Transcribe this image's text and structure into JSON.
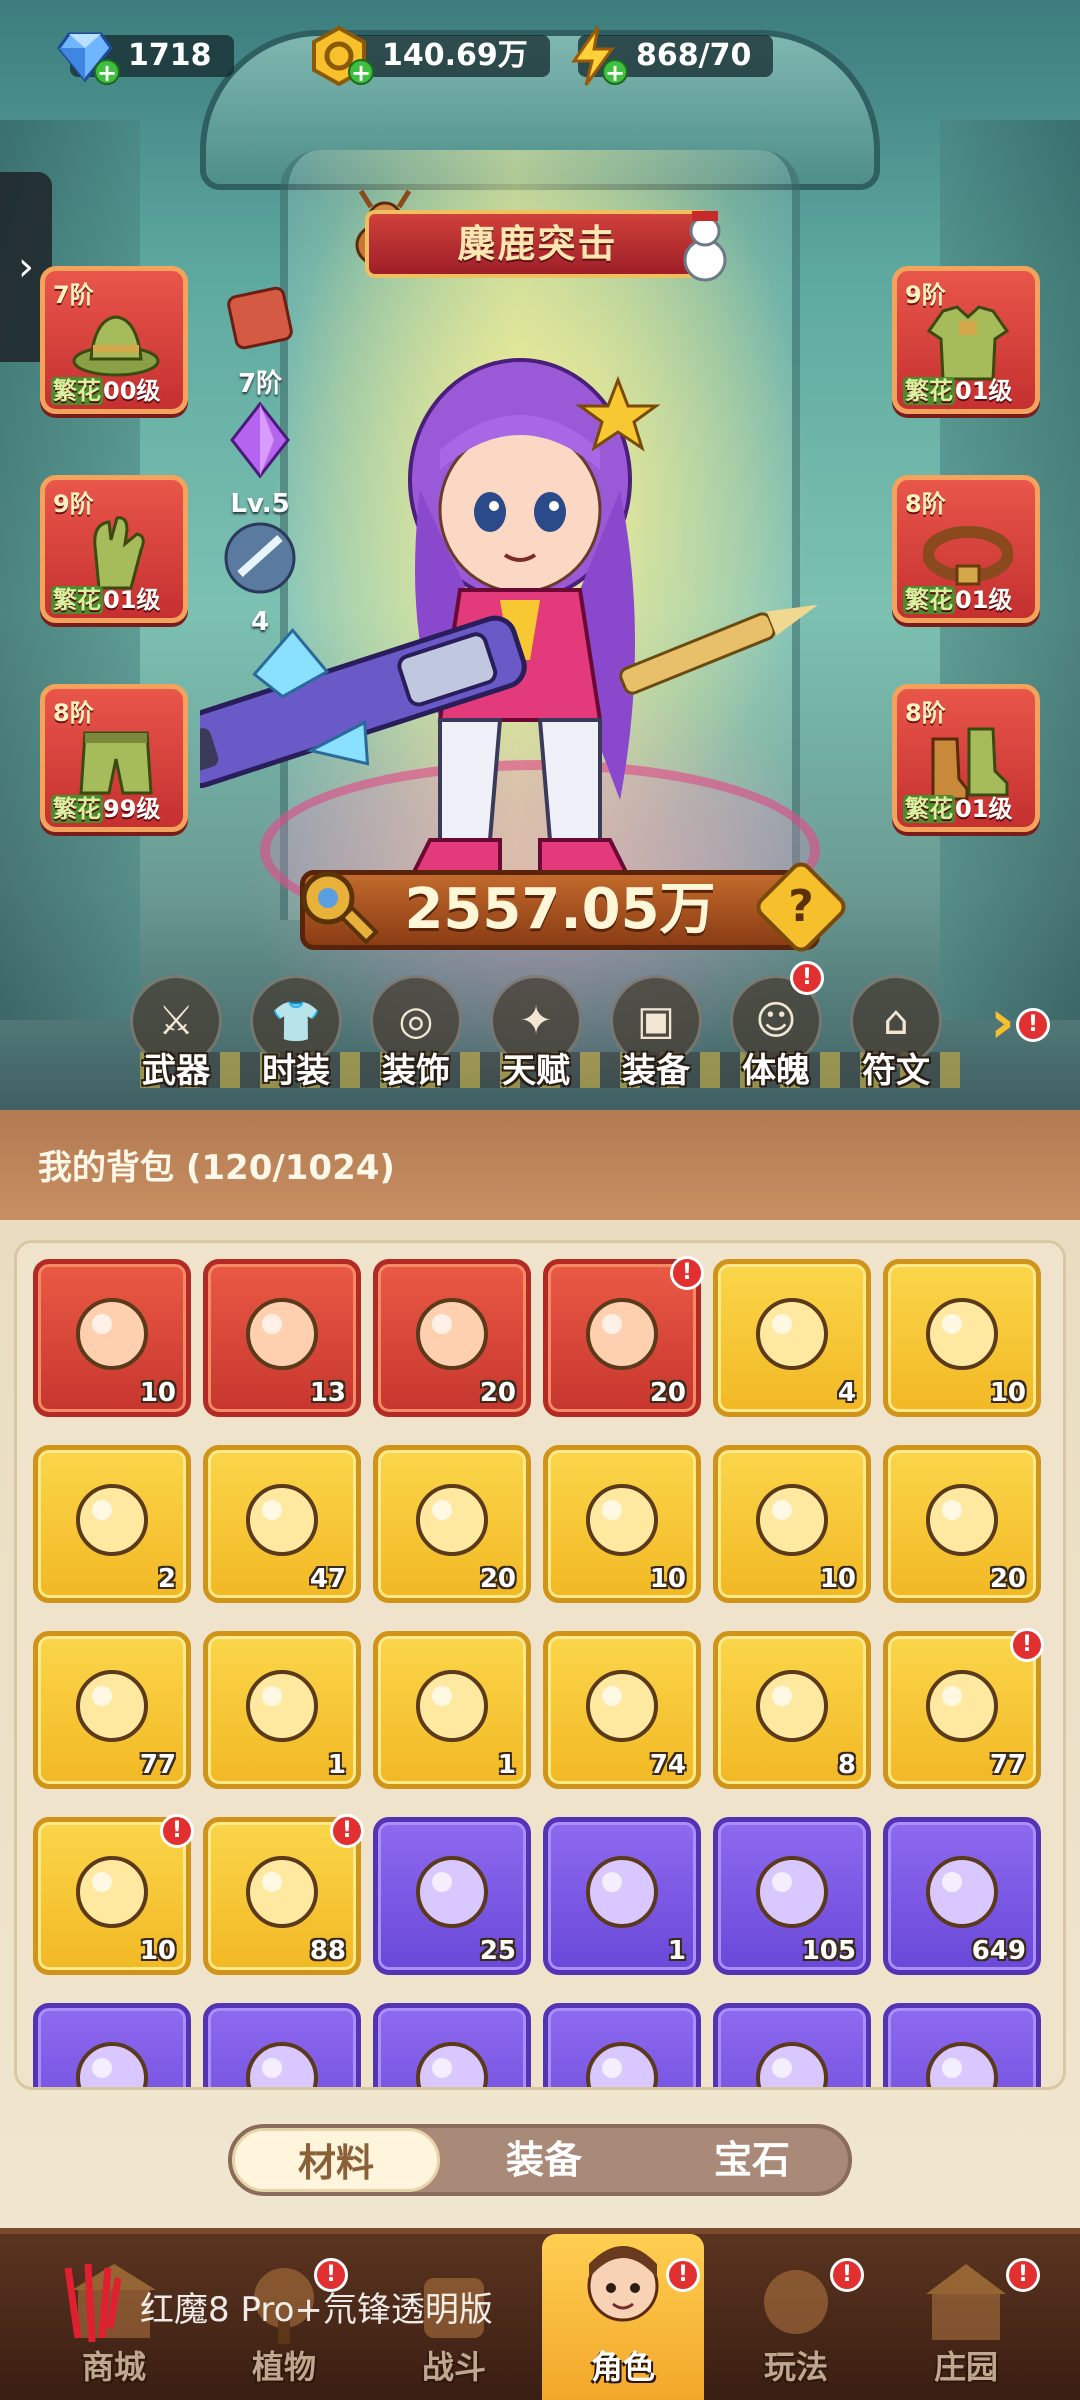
{
  "resources": [
    {
      "icon": "gem-icon",
      "value": "1718"
    },
    {
      "icon": "gold-coin-icon",
      "value": "140.69万"
    },
    {
      "icon": "energy-icon",
      "value": "868/70"
    }
  ],
  "event_banner": {
    "title": "麋鹿突击"
  },
  "equipment_left": [
    {
      "tier": "7阶",
      "label_prefix": "繁花",
      "label_level": "00级",
      "icon": "hat-icon"
    },
    {
      "tier": "9阶",
      "label_prefix": "繁花",
      "label_level": "01级",
      "icon": "glove-icon"
    },
    {
      "tier": "8阶",
      "label_prefix": "繁花",
      "label_level": "99级",
      "icon": "pants-icon"
    }
  ],
  "equipment_right": [
    {
      "tier": "9阶",
      "label_prefix": "繁花",
      "label_level": "01级",
      "icon": "armor-icon"
    },
    {
      "tier": "8阶",
      "label_prefix": "繁花",
      "label_level": "01级",
      "icon": "belt-icon"
    },
    {
      "tier": "8阶",
      "label_prefix": "繁花",
      "label_level": "01级",
      "icon": "boots-icon"
    }
  ],
  "mini_stats": [
    {
      "icon": "backpack-icon",
      "label": "7阶"
    },
    {
      "icon": "crystal-icon",
      "label": "Lv.5"
    },
    {
      "icon": "orb-icon",
      "label": "4"
    }
  ],
  "power": {
    "value": "2557.05万"
  },
  "functions": [
    {
      "label": "武器",
      "icon": "weapon-icon",
      "badge": false
    },
    {
      "label": "时装",
      "icon": "outfit-icon",
      "badge": false
    },
    {
      "label": "装饰",
      "icon": "mask-icon",
      "badge": false
    },
    {
      "label": "天赋",
      "icon": "talent-icon",
      "badge": false
    },
    {
      "label": "装备",
      "icon": "equipment-icon",
      "badge": false
    },
    {
      "label": "体魄",
      "icon": "physique-icon",
      "badge": true
    },
    {
      "label": "符文",
      "icon": "rune-icon",
      "badge": false
    }
  ],
  "backpack": {
    "title": "我的背包 (120/1024)",
    "items": [
      {
        "rarity": "red",
        "icon": "blue-crystal-icon",
        "count": "10",
        "badge": false
      },
      {
        "rarity": "red",
        "icon": "red-potion-icon",
        "count": "13",
        "badge": false
      },
      {
        "rarity": "red",
        "icon": "knot-emblem-icon",
        "count": "20",
        "badge": false
      },
      {
        "rarity": "red",
        "icon": "fire-flower-up-icon",
        "count": "20",
        "badge": true
      },
      {
        "rarity": "gold",
        "icon": "key-icon",
        "count": "4",
        "badge": false
      },
      {
        "rarity": "gold",
        "icon": "pyramid-icon",
        "count": "10",
        "badge": false
      },
      {
        "rarity": "gold",
        "icon": "golden-seed-icon",
        "count": "2",
        "badge": false
      },
      {
        "rarity": "gold",
        "icon": "dark-rune-stone-icon",
        "count": "47",
        "badge": false
      },
      {
        "rarity": "gold",
        "icon": "orange-potion-icon",
        "count": "20",
        "badge": false
      },
      {
        "rarity": "gold",
        "icon": "gold-ore-icon",
        "count": "10",
        "badge": false
      },
      {
        "rarity": "gold",
        "icon": "red-fruit-icon",
        "count": "10",
        "badge": false
      },
      {
        "rarity": "gold",
        "icon": "flower-pot-icon",
        "count": "20",
        "badge": false
      },
      {
        "rarity": "gold",
        "icon": "spell-book-icon",
        "count": "77",
        "badge": false
      },
      {
        "rarity": "gold",
        "icon": "red-flask-icon",
        "count": "1",
        "badge": false
      },
      {
        "rarity": "gold",
        "icon": "map-scroll-icon",
        "count": "1",
        "badge": false
      },
      {
        "rarity": "gold",
        "icon": "lily-flower-icon",
        "count": "74",
        "badge": false
      },
      {
        "rarity": "gold",
        "icon": "knot-emblem-gold-icon",
        "count": "8",
        "badge": false
      },
      {
        "rarity": "gold",
        "icon": "mystery-flame-icon",
        "count": "77",
        "badge": true
      },
      {
        "rarity": "gold",
        "icon": "mystery-flame-icon",
        "count": "10",
        "badge": true
      },
      {
        "rarity": "gold",
        "icon": "golden-flame-icon",
        "count": "88",
        "badge": true
      },
      {
        "rarity": "purple",
        "icon": "purple-potion-icon",
        "count": "25",
        "badge": false
      },
      {
        "rarity": "purple",
        "icon": "silver-key-icon",
        "count": "1",
        "badge": false
      },
      {
        "rarity": "purple",
        "icon": "hex-medal-icon",
        "count": "105",
        "badge": false
      },
      {
        "rarity": "purple",
        "icon": "feather-leaf-icon",
        "count": "649",
        "badge": false
      },
      {
        "rarity": "purple",
        "icon": "partial-item-icon",
        "count": "",
        "badge": false
      },
      {
        "rarity": "purple",
        "icon": "partial-item-icon",
        "count": "",
        "badge": false
      },
      {
        "rarity": "purple",
        "icon": "partial-item-icon",
        "count": "",
        "badge": false
      },
      {
        "rarity": "purple",
        "icon": "partial-item-icon",
        "count": "",
        "badge": false
      },
      {
        "rarity": "purple",
        "icon": "partial-item-icon",
        "count": "",
        "badge": false
      },
      {
        "rarity": "purple",
        "icon": "partial-item-icon",
        "count": "",
        "badge": false
      }
    ]
  },
  "categories": [
    {
      "label": "材料",
      "active": true
    },
    {
      "label": "装备",
      "active": false
    },
    {
      "label": "宝石",
      "active": false
    }
  ],
  "nav": [
    {
      "label": "商城",
      "icon": "shop-icon",
      "badge": false,
      "active": false
    },
    {
      "label": "植物",
      "icon": "plant-icon",
      "badge": true,
      "active": false
    },
    {
      "label": "战斗",
      "icon": "battle-icon",
      "badge": false,
      "active": false
    },
    {
      "label": "角色",
      "icon": "character-icon",
      "badge": true,
      "active": true
    },
    {
      "label": "玩法",
      "icon": "gameplay-icon",
      "badge": true,
      "active": false
    },
    {
      "label": "庄园",
      "icon": "manor-icon",
      "badge": true,
      "active": false
    }
  ],
  "watermark": "红魔8 Pro+氘锋透明版",
  "colors": {
    "red_slot": "#c53030",
    "gold_slot": "#f2b824",
    "purple_slot": "#6a48d8",
    "nav_active": "#f2a628"
  }
}
